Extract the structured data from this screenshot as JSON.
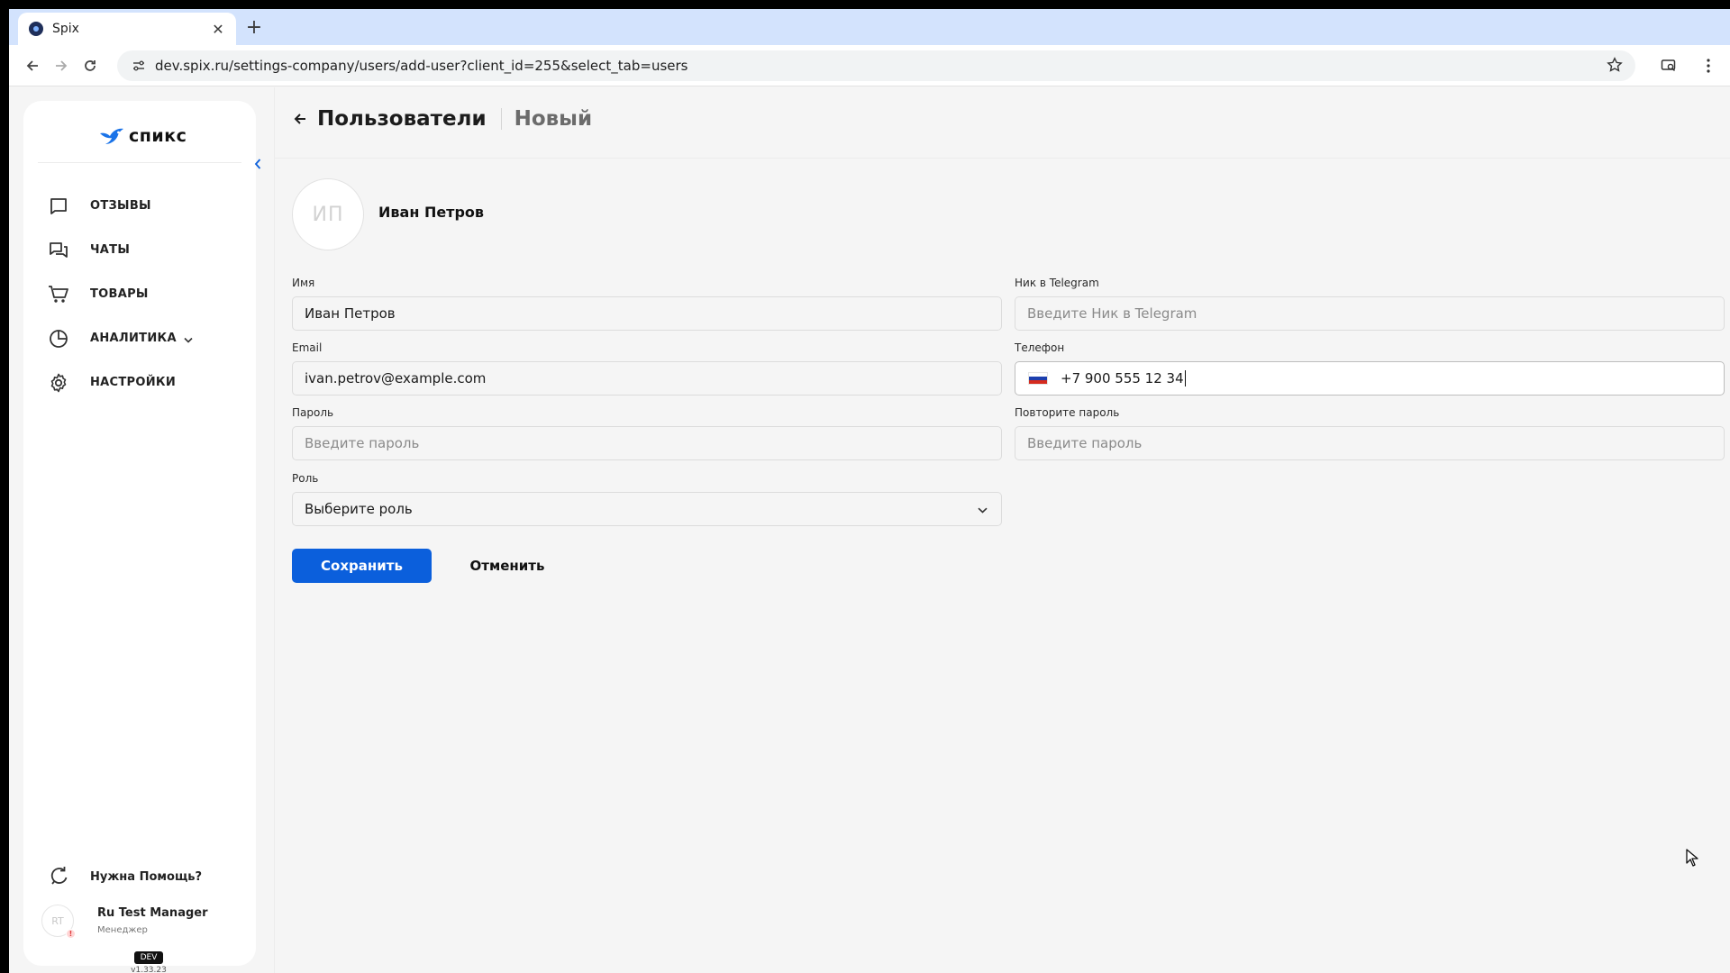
{
  "browser": {
    "tab_title": "Spix",
    "url": "dev.spix.ru/settings-company/users/add-user?client_id=255&select_tab=users"
  },
  "sidebar": {
    "logo_text": "спикс",
    "items": [
      {
        "label": "ОТЗЫВЫ",
        "icon": "reviews-icon"
      },
      {
        "label": "ЧАТЫ",
        "icon": "chats-icon"
      },
      {
        "label": "ТОВАРЫ",
        "icon": "cart-icon"
      },
      {
        "label": "АНАЛИТИКА",
        "icon": "analytics-icon"
      },
      {
        "label": "НАСТРОЙКИ",
        "icon": "gear-icon"
      }
    ],
    "help_label": "Нужна Помощь?",
    "user": {
      "initials": "RT",
      "name": "Ru Test Manager",
      "role": "Менеджер",
      "alert": "!"
    },
    "env_badge": "DEV",
    "version": "v1.33.23"
  },
  "header": {
    "title": "Пользователи",
    "subtitle": "Новый"
  },
  "profile": {
    "initials": "ИП",
    "name": "Иван Петров"
  },
  "form": {
    "name": {
      "label": "Имя",
      "value": "Иван Петров"
    },
    "telegram": {
      "label": "Ник в Telegram",
      "placeholder": "Введите Ник в Telegram"
    },
    "email": {
      "label": "Email",
      "value": "ivan.petrov@example.com"
    },
    "phone": {
      "label": "Телефон",
      "value": "+7 900 555 12 34"
    },
    "password": {
      "label": "Пароль",
      "placeholder": "Введите пароль"
    },
    "password_repeat": {
      "label": "Повторите пароль",
      "placeholder": "Введите пароль"
    },
    "role": {
      "label": "Роль",
      "value": "Выберите роль"
    }
  },
  "actions": {
    "save_label": "Сохранить",
    "cancel_label": "Отменить"
  },
  "colors": {
    "accent": "#0b5fdc",
    "logo_blue": "#1a73e8"
  }
}
